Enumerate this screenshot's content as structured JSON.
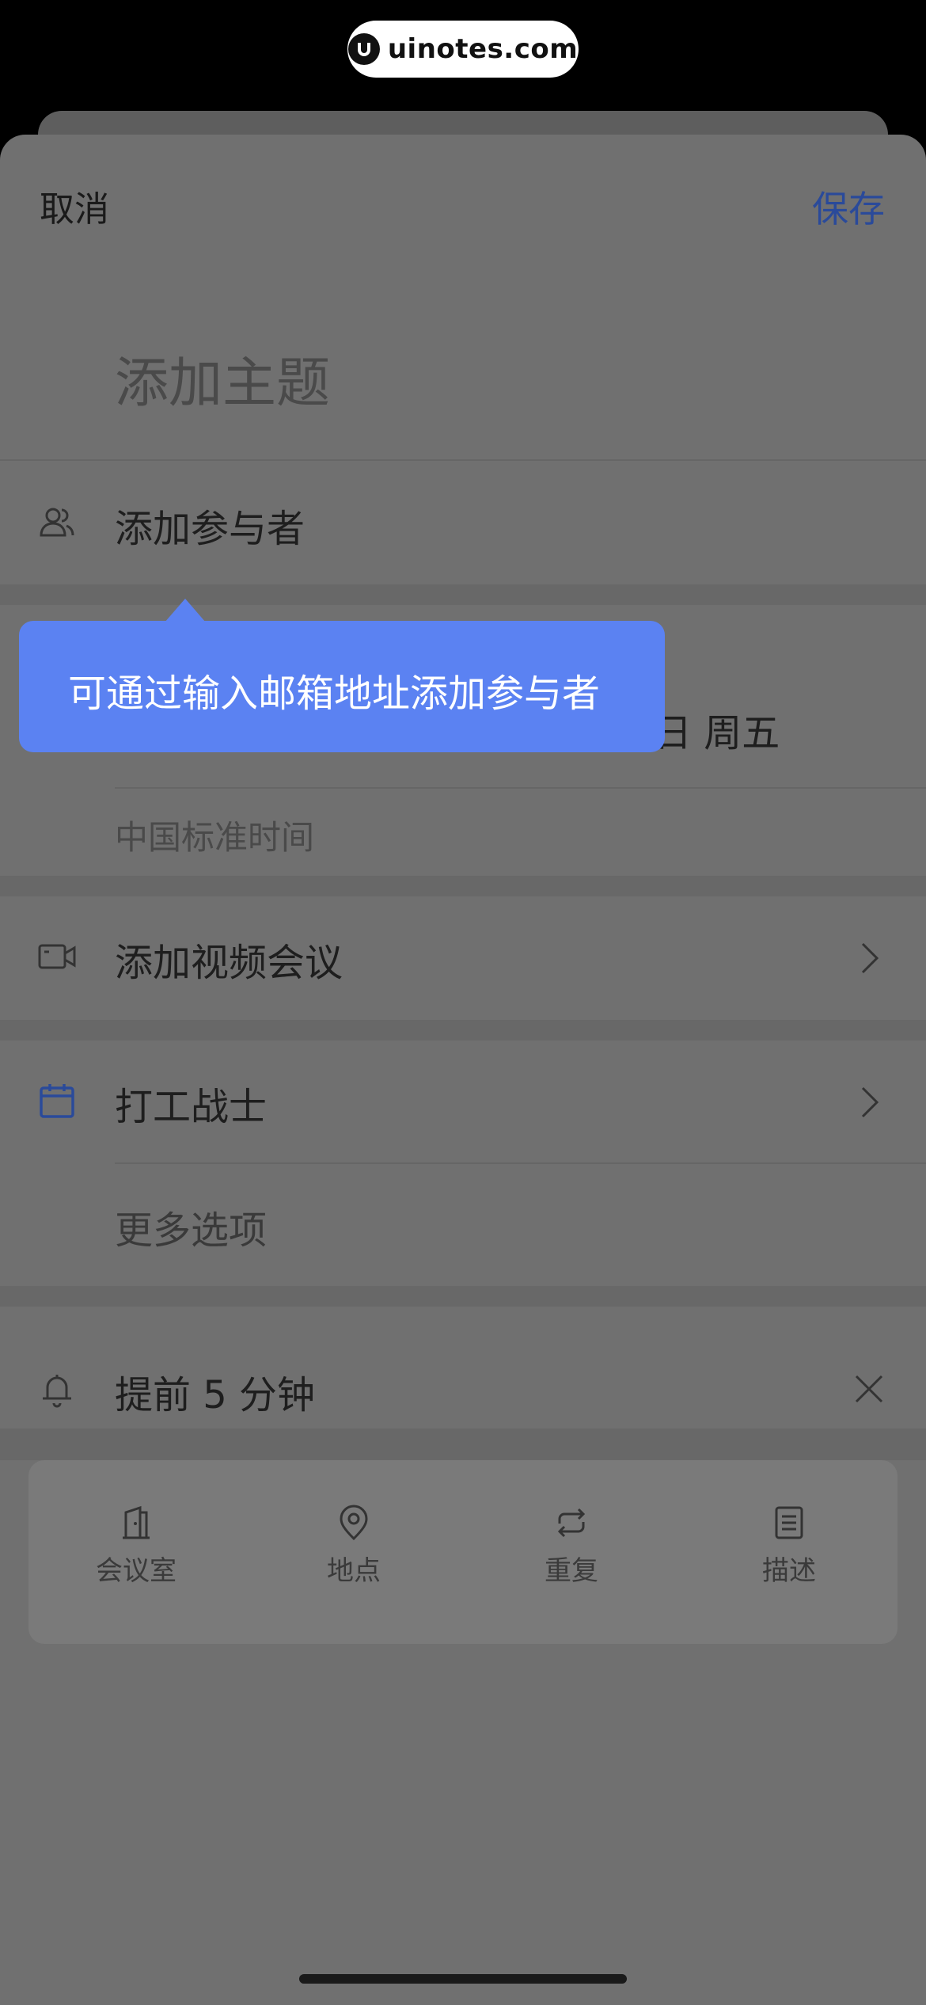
{
  "watermark": {
    "text": "uinotes.com",
    "icon": "uinotes-logo-icon"
  },
  "nav": {
    "cancel": "取消",
    "save": "保存"
  },
  "subject_placeholder": "添加主题",
  "participants": {
    "label": "添加参与者",
    "icon": "people-icon"
  },
  "datetime": {
    "date_partial": "日  周五",
    "timezone": "中国标准时间"
  },
  "video": {
    "label": "添加视频会议",
    "icon": "video-camera-icon"
  },
  "calendar": {
    "label": "打工战士",
    "icon": "calendar-icon",
    "more": "更多选项"
  },
  "reminder": {
    "label": "提前 5 分钟",
    "icon": "bell-icon"
  },
  "tools": [
    {
      "label": "会议室",
      "icon": "door-icon"
    },
    {
      "label": "地点",
      "icon": "location-pin-icon"
    },
    {
      "label": "重复",
      "icon": "repeat-icon"
    },
    {
      "label": "描述",
      "icon": "document-icon"
    }
  ],
  "tooltip": {
    "text": "可通过输入邮箱地址添加参与者"
  },
  "colors": {
    "accent": "#2a4a9a",
    "tooltip": "#5b82f2",
    "overlay": "#707070"
  }
}
